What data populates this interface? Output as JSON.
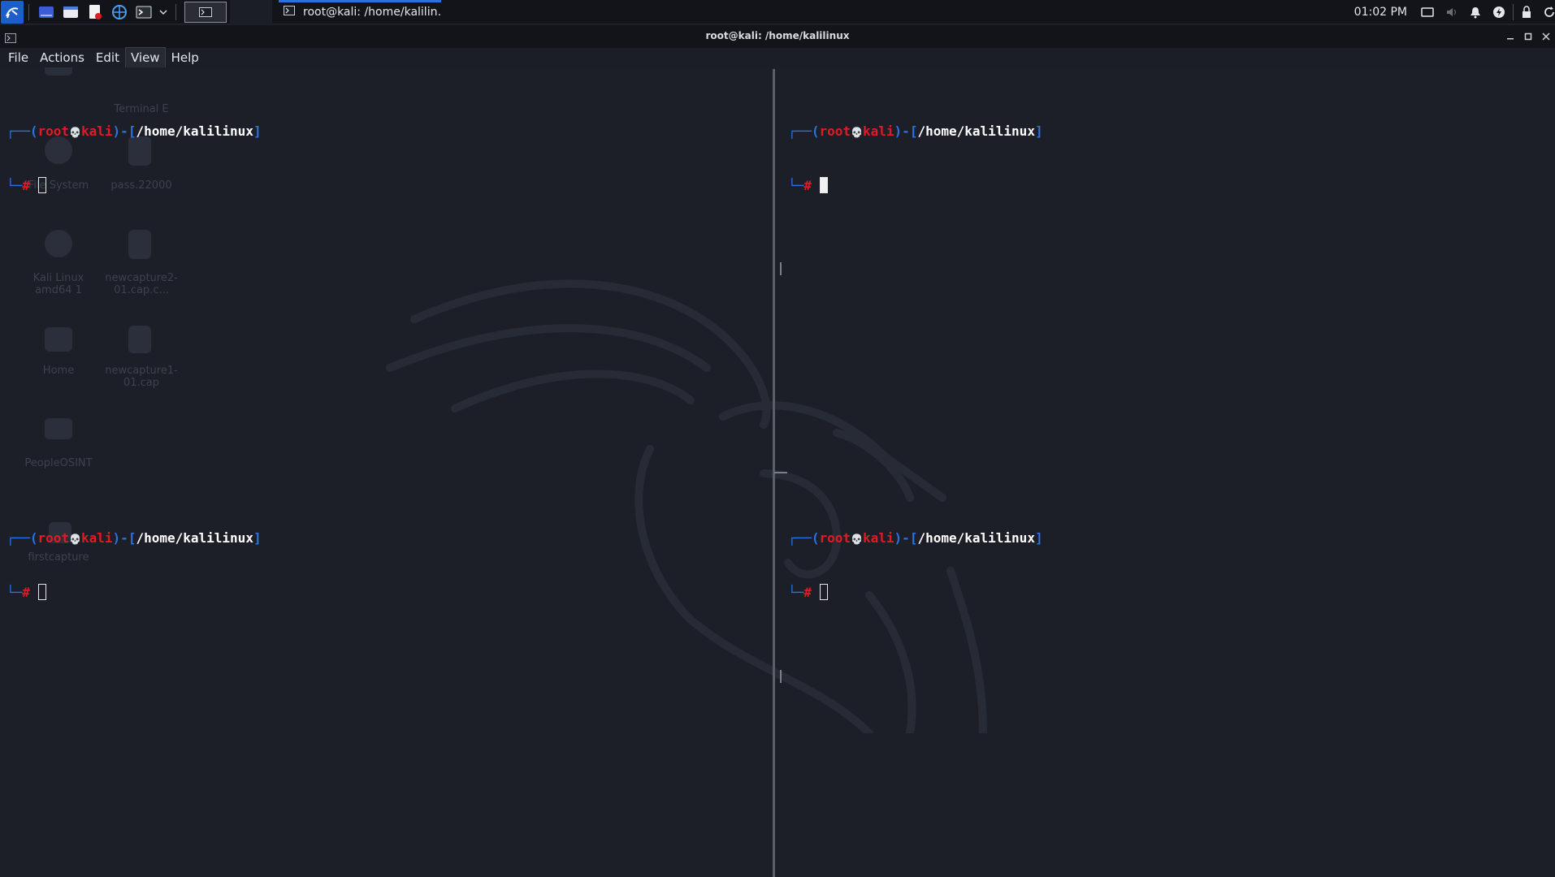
{
  "panel": {
    "task_title": "root@kali: /home/kalilin…",
    "clock": "01:02 PM",
    "launcher_icons": [
      "kali-menu-icon",
      "desktop-icon",
      "file-manager-icon",
      "text-editor-icon",
      "browser-icon",
      "terminal-icon"
    ],
    "tray_icons": [
      "display-icon",
      "volume-icon",
      "notification-icon",
      "power-icon",
      "lock-icon",
      "refresh-icon"
    ]
  },
  "window": {
    "title": "root@kali: /home/kalilinux"
  },
  "menubar": {
    "items": [
      "File",
      "Actions",
      "Edit",
      "View",
      "Help"
    ],
    "active": "View"
  },
  "prompt": {
    "open": "┌──(",
    "user": "root",
    "skull": "💀",
    "host": "kali",
    "mid": ")-[",
    "path": "/home/kalilinux",
    "close": "]",
    "line2": "└─",
    "hash": "#"
  },
  "panes": [
    "top-left",
    "top-right",
    "bottom-left",
    "bottom-right"
  ],
  "desktop_ghost_labels": [
    "Terminal E",
    "File System",
    "pass.22000",
    "Kali Linux amd64 1",
    "newcapture2-01.cap.c...",
    "Home",
    "newcapture1-01.cap",
    "PeopleOSINT",
    "firstcapture"
  ],
  "colors": {
    "accent": "#2f6fe0",
    "prompt_blue": "#2a73e2",
    "prompt_red": "#e01b24",
    "background": "#1c1f27"
  }
}
